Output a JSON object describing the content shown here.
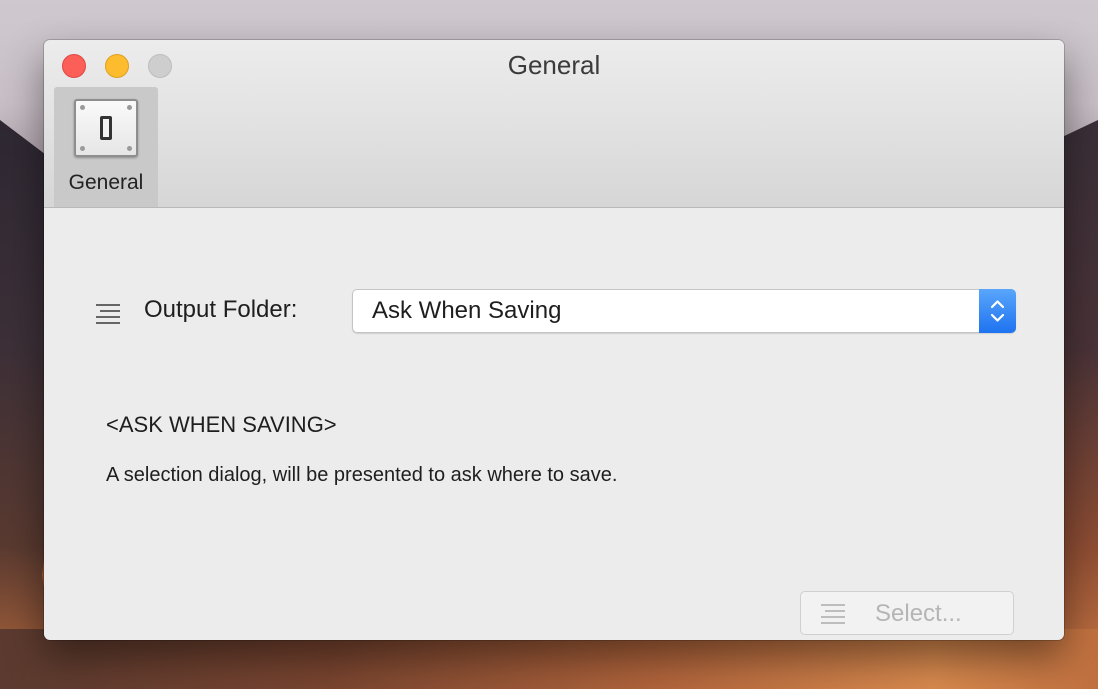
{
  "window": {
    "title": "General"
  },
  "toolbar": {
    "items": [
      {
        "label": "General",
        "icon": "toggle-switch-icon",
        "selected": true
      }
    ]
  },
  "output_folder": {
    "label": "Output Folder:",
    "selected_value": "Ask When Saving",
    "icon": "list-icon"
  },
  "info": {
    "heading": "<ASK WHEN SAVING>",
    "description": "A selection dialog, will be presented to ask where to save."
  },
  "select_button": {
    "label": "Select...",
    "icon": "list-icon",
    "enabled": false
  },
  "colors": {
    "close": "#fc5f57",
    "minimize": "#fdbc2e",
    "zoom_disabled": "#cecece",
    "accent": "#1e73f0"
  }
}
